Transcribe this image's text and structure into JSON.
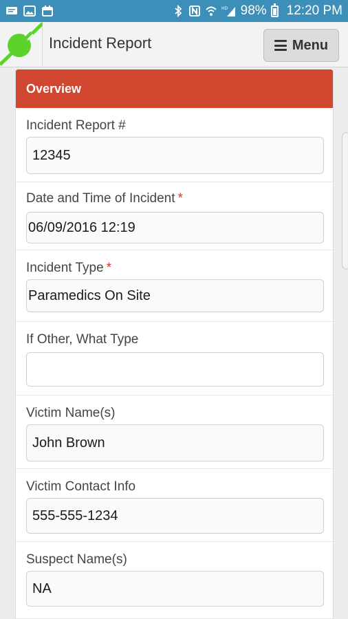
{
  "status_bar": {
    "battery": "98%",
    "time": "12:20 PM"
  },
  "header": {
    "title": "Incident Report",
    "menu_label": "Menu"
  },
  "form": {
    "section_title": "Overview",
    "fields": [
      {
        "label": "Incident Report #",
        "value": "12345",
        "required": false
      },
      {
        "label": "Date and Time of Incident",
        "value": "06/09/2016 12:19",
        "required": true
      },
      {
        "label": "Incident Type",
        "value": "Paramedics On Site",
        "required": true
      },
      {
        "label": "If Other, What Type",
        "value": "",
        "required": false
      },
      {
        "label": "Victim Name(s)",
        "value": "John Brown",
        "required": false
      },
      {
        "label": "Victim Contact Info",
        "value": "555-555-1234",
        "required": false
      },
      {
        "label": "Suspect Name(s)",
        "value": "NA",
        "required": false
      }
    ],
    "required_marker": "*"
  },
  "colors": {
    "status_bar": "#3c8fb8",
    "section_header": "#d0462e",
    "required": "#d9372b",
    "logo_green": "#5cd32c"
  }
}
